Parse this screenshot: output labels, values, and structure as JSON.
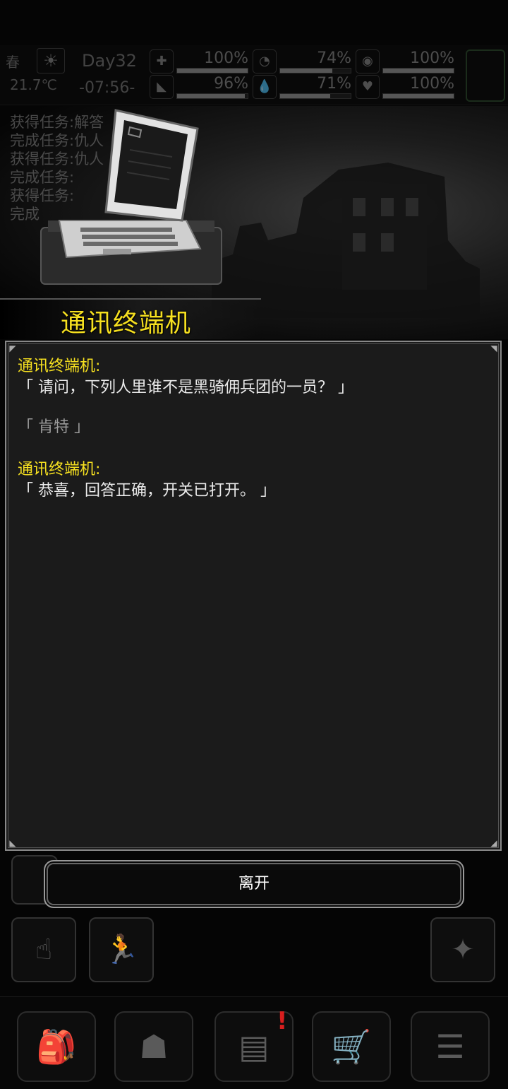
{
  "status": {
    "season": "春",
    "temperature": "21.7℃",
    "day": "Day32",
    "time": "-07:56-",
    "stats": [
      {
        "name": "health",
        "icon": "medkit-icon",
        "value": "100%",
        "level": 1.0
      },
      {
        "name": "hunger",
        "icon": "stomach-icon",
        "value": "74%",
        "level": 0.74
      },
      {
        "name": "mood",
        "icon": "mask-icon",
        "value": "100%",
        "level": 1.0
      },
      {
        "name": "stamina",
        "icon": "boot-icon",
        "value": "96%",
        "level": 0.96
      },
      {
        "name": "thirst",
        "icon": "water-drop-icon",
        "value": "71%",
        "level": 0.71
      },
      {
        "name": "heart",
        "icon": "heart-icon",
        "value": "100%",
        "level": 1.0
      }
    ]
  },
  "background_log": [
    "获得任务:解答",
    "完成任务:仇人",
    "获得任务:仇人",
    "完成任务:",
    "获得任务:",
    "完成"
  ],
  "title": "通讯终端机",
  "dialog": {
    "messages": [
      {
        "speaker": "通讯终端机:",
        "text": "「 请问，下列人里谁不是黑骑佣兵团的一员？ 」"
      },
      {
        "choice": "「 肯特 」"
      },
      {
        "speaker": "通讯终端机:",
        "text": "「 恭喜，回答正确，开关已打开。 」"
      }
    ]
  },
  "leave_button": "离开",
  "nav": [
    {
      "name": "backpack",
      "icon": "backpack-icon",
      "glyph": "🎒"
    },
    {
      "name": "skills",
      "icon": "brain-head-icon",
      "glyph": "☗"
    },
    {
      "name": "journal",
      "icon": "notebook-icon",
      "glyph": "▤",
      "alert": "!"
    },
    {
      "name": "shop",
      "icon": "cart-icon",
      "glyph": "🛒"
    },
    {
      "name": "menu",
      "icon": "list-menu-icon",
      "glyph": "☰"
    }
  ],
  "colors": {
    "accent_yellow": "#f6e020",
    "alert_red": "#d81e1e"
  }
}
